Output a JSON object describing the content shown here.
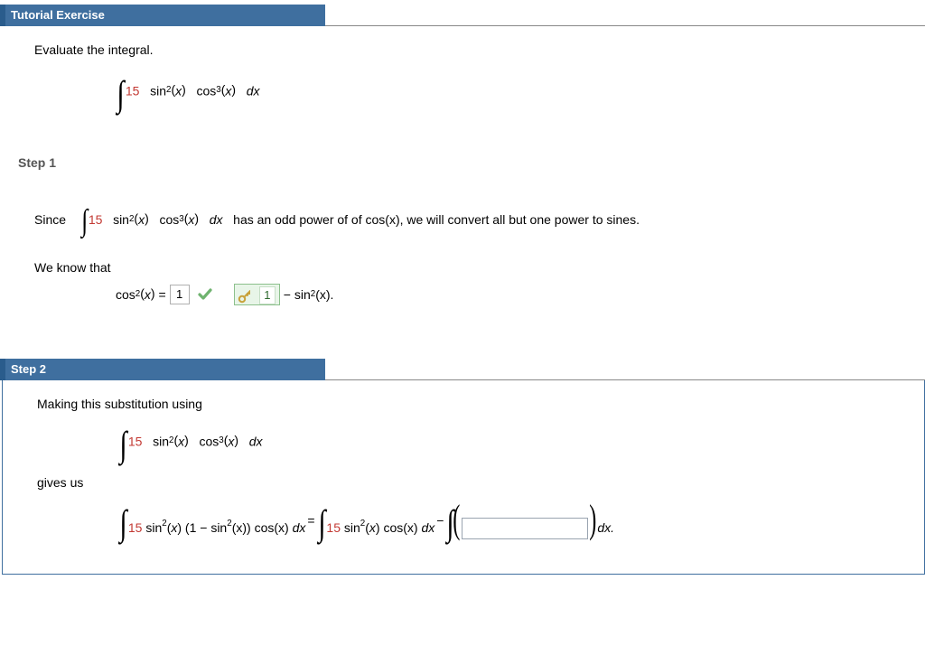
{
  "header1": "Tutorial Exercise",
  "intro": "Evaluate the integral.",
  "coef15": "15",
  "expr_sin2": "sin",
  "sq": "2",
  "cu": "3",
  "of_x": "x",
  "dx": "dx",
  "expr_cos": "cos",
  "step1_title": "Step 1",
  "step1_since": "Since",
  "step1_tail": " has an odd power of of cos(x), we will convert all but one power to sines.",
  "we_know": "We know that",
  "cos2_label_pre": "cos",
  "cos2_eq": " = ",
  "answer_box_value": "1",
  "revealed_value": "1",
  "minus_sin2_tail": " − sin",
  "sin2_post": "(x).",
  "header2": "Step 2",
  "step2_intro": "Making this substitution using",
  "gives_us": "gives us",
  "one_minus": "(1 − sin",
  "post_paren": "(x)) cos(x) ",
  "eq_sign": " = ",
  "cosx": " cos(x) ",
  "minus_symbol": " − ",
  "final_dx": " dx."
}
